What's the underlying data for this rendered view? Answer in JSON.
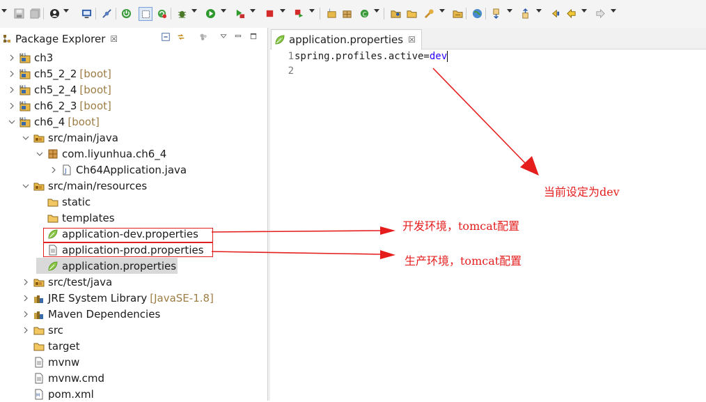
{
  "toolbar": {
    "icons": [
      "new-wizard-icon",
      "save-icon",
      "save-all-icon",
      "profile-icon",
      "terminal-icon",
      "skip-breakpoints-icon",
      "spring-boot-dashboard-icon",
      "toggle-selection-icon",
      "refresh-icon",
      "debug-icon",
      "run-icon",
      "run-external-icon",
      "stop-icon",
      "coverage-icon",
      "new-java-project-icon",
      "new-package-icon",
      "new-class-icon",
      "open-type-icon",
      "open-task-icon",
      "search-icon",
      "open-perspective-icon",
      "globe-icon",
      "next-annotation-icon",
      "previous-annotation-icon",
      "last-edit-icon",
      "back-icon",
      "forward-icon"
    ]
  },
  "package_explorer": {
    "tab_label": "Package Explorer",
    "close_glyph": "☒",
    "tree": [
      {
        "label": "ch3",
        "decoration": "",
        "icon": "maven-project-icon"
      },
      {
        "label": "ch5_2_2",
        "decoration": "[boot]",
        "icon": "maven-project-icon"
      },
      {
        "label": "ch5_2_4",
        "decoration": "[boot]",
        "icon": "maven-project-icon"
      },
      {
        "label": "ch6_2_3",
        "decoration": "[boot]",
        "icon": "maven-project-icon"
      },
      {
        "label": "ch6_4",
        "decoration": "[boot]",
        "icon": "maven-project-icon"
      },
      {
        "label": "src/main/java",
        "icon": "source-folder-icon"
      },
      {
        "label": "com.liyunhua.ch6_4",
        "icon": "package-icon"
      },
      {
        "label": "Ch64Application.java",
        "icon": "java-file-icon"
      },
      {
        "label": "src/main/resources",
        "icon": "source-folder-icon"
      },
      {
        "label": "static",
        "icon": "folder-icon"
      },
      {
        "label": "templates",
        "icon": "folder-icon"
      },
      {
        "label": "application-dev.properties",
        "icon": "spring-properties-icon"
      },
      {
        "label": "application-prod.properties",
        "icon": "text-file-icon"
      },
      {
        "label": "application.properties",
        "icon": "spring-properties-icon"
      },
      {
        "label": "src/test/java",
        "icon": "source-folder-icon"
      },
      {
        "label": "JRE System Library",
        "decoration": "[JavaSE-1.8]",
        "icon": "library-icon"
      },
      {
        "label": "Maven Dependencies",
        "icon": "library-icon"
      },
      {
        "label": "src",
        "icon": "folder-icon"
      },
      {
        "label": "target",
        "icon": "folder-icon"
      },
      {
        "label": "mvnw",
        "icon": "text-file-icon"
      },
      {
        "label": "mvnw.cmd",
        "icon": "text-file-icon"
      },
      {
        "label": "pom.xml",
        "icon": "xml-file-icon"
      }
    ]
  },
  "editor": {
    "tab_label": "application.properties",
    "close_glyph": "☒",
    "lines": [
      {
        "number": "1",
        "key": "spring.profiles.active=",
        "value": "dev"
      },
      {
        "number": "2",
        "key": "",
        "value": ""
      }
    ]
  },
  "annotations": {
    "current_setting": "当前设定为dev",
    "dev_env": "开发环境，tomcat配置",
    "prod_env": "生产环境，tomcat配置"
  },
  "colors": {
    "annotation_red": "#e51d1d",
    "boot_decoration": "#9e7d45",
    "property_value": "#2a00ff",
    "selection_bg": "#d9d9d9"
  }
}
